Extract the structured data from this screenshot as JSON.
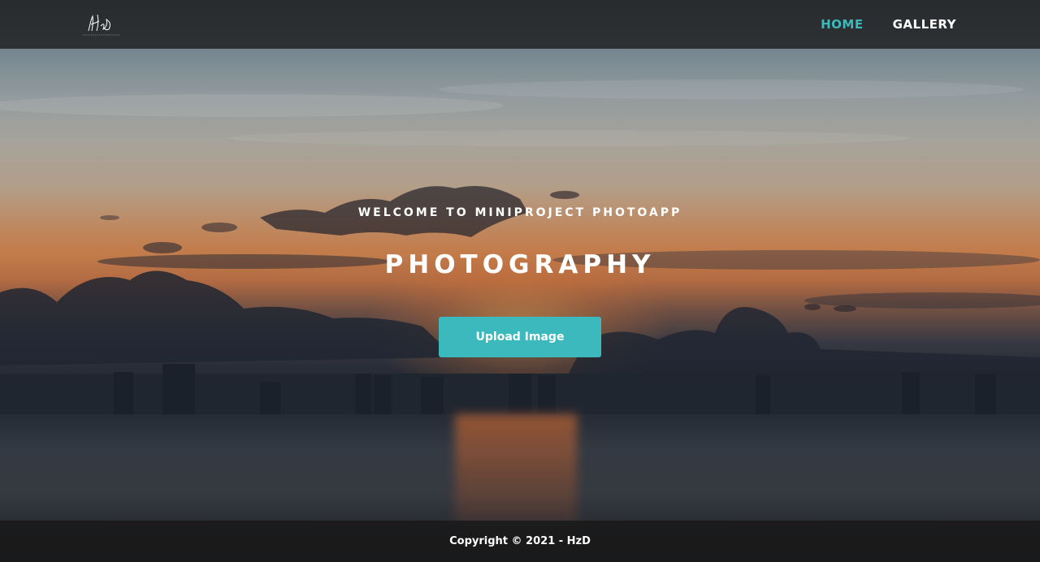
{
  "nav": {
    "logo_text": "HzD",
    "logo_subtext": "PHOTOGRAPHY",
    "links": [
      {
        "label": "HOME",
        "active": true
      },
      {
        "label": "GALLERY",
        "active": false
      }
    ]
  },
  "hero": {
    "welcome": "WELCOME TO MINIPROJECT PHOTOAPP",
    "title": "PHOTOGRAPHY",
    "upload_button": "Upload Image"
  },
  "footer": {
    "copyright": "Copyright © 2021 - HzD"
  },
  "colors": {
    "accent": "#3cb9bd",
    "navbar_bg": "#1e1e1e",
    "text": "#ffffff"
  }
}
